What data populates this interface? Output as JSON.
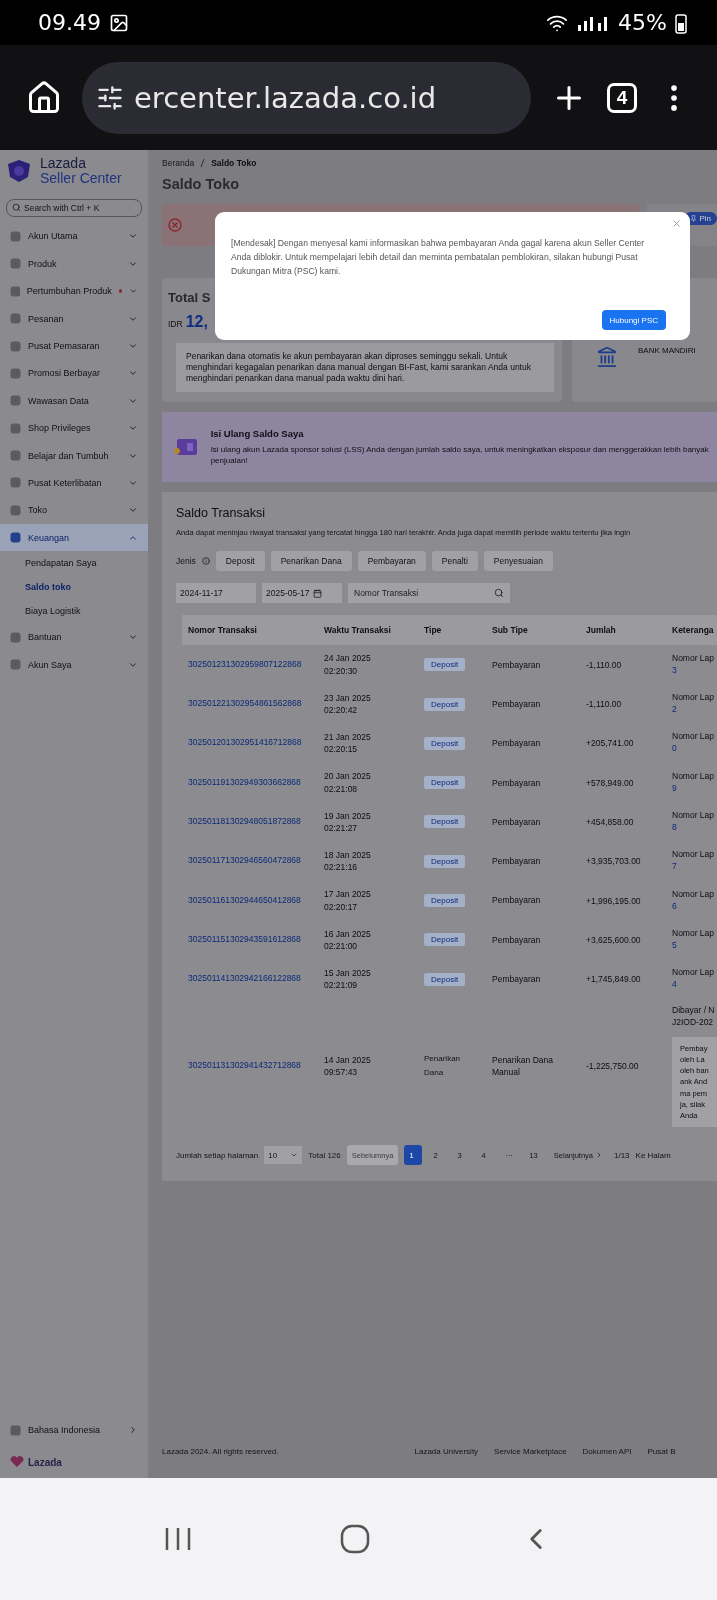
{
  "status_bar": {
    "time": "09.49",
    "battery": "45%"
  },
  "browser": {
    "url": "ercenter.lazada.co.id",
    "tab_count": "4"
  },
  "sidebar": {
    "brand": "Lazada",
    "brand_sub": "Seller Center",
    "search_placeholder": "Search with Ctrl + K",
    "items": [
      {
        "label": "Akun Utama",
        "expanded": false,
        "selected": false,
        "alert": false
      },
      {
        "label": "Produk",
        "expanded": false,
        "selected": false,
        "alert": false
      },
      {
        "label": "Pertumbuhan Produk",
        "expanded": false,
        "selected": false,
        "alert": true
      },
      {
        "label": "Pesanan",
        "expanded": false,
        "selected": false,
        "alert": false
      },
      {
        "label": "Pusat Pemasaran",
        "expanded": false,
        "selected": false,
        "alert": false
      },
      {
        "label": "Promosi Berbayar",
        "expanded": false,
        "selected": false,
        "alert": false
      },
      {
        "label": "Wawasan Data",
        "expanded": false,
        "selected": false,
        "alert": false
      },
      {
        "label": "Shop Privileges",
        "expanded": false,
        "selected": false,
        "alert": false
      },
      {
        "label": "Belajar dan Tumbuh",
        "expanded": false,
        "selected": false,
        "alert": false
      },
      {
        "label": "Pusat Keterlibatan",
        "expanded": false,
        "selected": false,
        "alert": false
      },
      {
        "label": "Toko",
        "expanded": false,
        "selected": false,
        "alert": false
      },
      {
        "label": "Keuangan",
        "expanded": true,
        "selected": true,
        "alert": false,
        "children": [
          {
            "label": "Pendapatan Saya",
            "selected": false
          },
          {
            "label": "Saldo toko",
            "selected": true
          },
          {
            "label": "Biaya Logistik",
            "selected": false
          }
        ]
      },
      {
        "label": "Bantuan",
        "expanded": false,
        "selected": false,
        "alert": false
      },
      {
        "label": "Akun Saya",
        "expanded": false,
        "selected": false,
        "alert": false
      }
    ],
    "language": "Bahasa Indonesia",
    "footer_logo": "Lazada"
  },
  "breadcrumb": [
    "Beranda",
    "Saldo Toko"
  ],
  "page_title": "Saldo Toko",
  "pin_label": "Pin",
  "balance": {
    "title": "Total S",
    "currency": "IDR",
    "amount": "12,",
    "notice": "Penarikan dana otomatis ke akun pembayaran akan diproses seminggu sekali. Untuk menghindari kegagalan penarikan dana manual dengan BI-Fast, kami sarankan Anda untuk menghindari penarikan dana manual pada waktu dini hari.",
    "bank": "BANK MANDIRI"
  },
  "topup": {
    "title": "Isi Ulang Saldo Saya",
    "text": "Isi ulang akun Lazada sponsor solusi (LSS) Anda dengan jumlah saldo saya, untuk meningkatkan eksposur dan menggerakkan lebih banyak penjualan!"
  },
  "transactions": {
    "title": "Saldo Transaksi",
    "description": "Anda dapat meninjau riwayat transaksi yang tercatat hingga 180 hari terakhir. Anda juga dapat memilih periode waktu tertentu jika ingin",
    "filter_label": "Jenis",
    "filters": [
      {
        "label": "Deposit",
        "selected": false
      },
      {
        "label": "Penarikan Dana",
        "selected": false
      },
      {
        "label": "Pembayaran",
        "selected": false
      },
      {
        "label": "Penalti",
        "selected": false
      },
      {
        "label": "Penyesuaian",
        "selected": false
      }
    ],
    "start_date": "2024-11-17",
    "end_date": "2025-05-17",
    "search_placeholder": "Nomor Transaksi",
    "columns": [
      "Nomor Transaksi",
      "Waktu Transaksi",
      "Tipe",
      "Sub Tipe",
      "Jumlah",
      "Keteranga"
    ],
    "rows": [
      {
        "id": "302501231302959807122868",
        "time": "24 Jan 2025 02:20:30",
        "type": "Deposit",
        "kind": "badge",
        "subtype": "Pembayaran",
        "amount": "-1,110.00",
        "note": [
          "Nomor Lap"
        ],
        "ref": "3"
      },
      {
        "id": "302501221302954861562868",
        "time": "23 Jan 2025 02:20:42",
        "type": "Deposit",
        "kind": "badge",
        "subtype": "Pembayaran",
        "amount": "-1,110.00",
        "note": [
          "Nomor Lap"
        ],
        "ref": "2"
      },
      {
        "id": "302501201302951416712868",
        "time": "21 Jan 2025 02:20:15",
        "type": "Deposit",
        "kind": "badge",
        "subtype": "Pembayaran",
        "amount": "+205,741.00",
        "note": [
          "Nomor Lap"
        ],
        "ref": "0"
      },
      {
        "id": "302501191302949303662868",
        "time": "20 Jan 2025 02:21:08",
        "type": "Deposit",
        "kind": "badge",
        "subtype": "Pembayaran",
        "amount": "+578,949.00",
        "note": [
          "Nomor Lap"
        ],
        "ref": "9"
      },
      {
        "id": "302501181302948051872868",
        "time": "19 Jan 2025 02:21:27",
        "type": "Deposit",
        "kind": "badge",
        "subtype": "Pembayaran",
        "amount": "+454,858.00",
        "note": [
          "Nomor Lap"
        ],
        "ref": "8"
      },
      {
        "id": "302501171302946560472868",
        "time": "18 Jan 2025 02:21:16",
        "type": "Deposit",
        "kind": "badge",
        "subtype": "Pembayaran",
        "amount": "+3,935,703.00",
        "note": [
          "Nomor Lap"
        ],
        "ref": "7"
      },
      {
        "id": "302501161302944650412868",
        "time": "17 Jan 2025 02:20:17",
        "type": "Deposit",
        "kind": "badge",
        "subtype": "Pembayaran",
        "amount": "+1,996,195.00",
        "note": [
          "Nomor Lap"
        ],
        "ref": "6"
      },
      {
        "id": "302501151302943591612868",
        "time": "16 Jan 2025 02:21:00",
        "type": "Deposit",
        "kind": "badge",
        "subtype": "Pembayaran",
        "amount": "+3,625,600.00",
        "note": [
          "Nomor Lap"
        ],
        "ref": "5"
      },
      {
        "id": "302501141302942166122868",
        "time": "15 Jan 2025 02:21:09",
        "type": "Deposit",
        "kind": "badge",
        "subtype": "Pembayaran",
        "amount": "+1,745,849.00",
        "note": [
          "Nomor Lap"
        ],
        "ref": "4"
      },
      {
        "id": "302501131302941432712868",
        "time": "14 Jan 2025 09:57:43",
        "type": "Penarikan Dana",
        "kind": "text",
        "subtype": "Penarikan Dana Manual",
        "amount": "-1,225,750.00",
        "note": [
          "Dibayar / N",
          "J2IOD-202"
        ],
        "note_box": [
          "Pembay",
          "oleh La",
          "oleh ban",
          "ank And",
          "ma pem",
          "ja, silak",
          "Anda"
        ]
      }
    ]
  },
  "pagination": {
    "page_size_label": "Jumlah setiap halaman",
    "page_size": "10",
    "total": "Total 126",
    "prev": "Sebelumnya",
    "prev_disabled": true,
    "pages": [
      {
        "label": "1",
        "selected": true
      },
      {
        "label": "2",
        "selected": false
      },
      {
        "label": "3",
        "selected": false
      },
      {
        "label": "4",
        "selected": false
      },
      {
        "label": "···",
        "selected": false
      },
      {
        "label": "13",
        "selected": false
      }
    ],
    "next": "Selanjutnya",
    "counter": "1/13",
    "goto": "Ke Halam"
  },
  "footer": {
    "copyright": "Lazada 2024. All rights reserved.",
    "links": [
      "Lazada University",
      "Service Marketplace",
      "Dokumen API",
      "Pusat B"
    ]
  },
  "modal": {
    "message": "[Mendesak] Dengan menyesal kami informasikan bahwa pembayaran Anda gagal karena akun Seller Center Anda diblokir. Untuk mempelajari lebih detail dan meminta pembatalan pemblokiran, silakan hubungi Pusat Dukungan Mitra (PSC) kami.",
    "button": "Hubungi PSC"
  }
}
